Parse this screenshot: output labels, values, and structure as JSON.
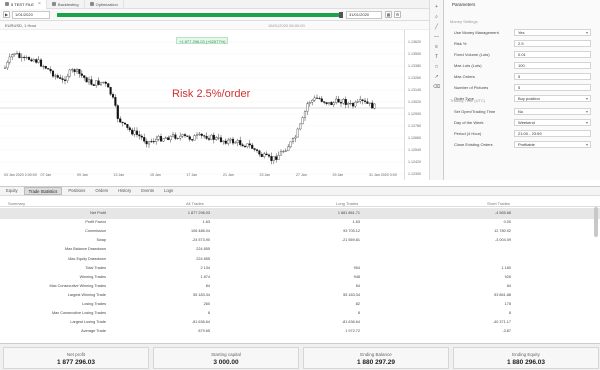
{
  "tabs": [
    {
      "label": "5 TEST FILE",
      "active": true
    },
    {
      "label": "Backtesting",
      "active": false
    },
    {
      "label": "Optimization",
      "active": false
    }
  ],
  "toolbar": {
    "start_date": "1/01/2020",
    "end_date": "31/01/2020",
    "progress_pct": 100
  },
  "chart": {
    "symbol": "EURUSD, 1 Hour",
    "cursor_time": "16/01/2020 06:00:00",
    "profit_label": "+1 877 296.03 (+62577%)",
    "annotation": "Risk 2.5%/order",
    "price_labels": [
      "1.13620",
      "1.13500",
      "1.13380",
      "1.13260",
      "1.13140",
      "1.13020",
      "1.12900",
      "1.12780",
      "1.12660",
      "1.12540",
      "1.12420",
      "1.12300"
    ],
    "current_price": "1.12700",
    "time_labels": [
      "03 Jan 2020 2:00:00",
      "07 Jan",
      "09 Jan",
      "13 Jan",
      "15 Jan",
      "17 Jan",
      "21 Jan",
      "23 Jan",
      "27 Jan",
      "29 Jan",
      "31 Jan 2020 0:00"
    ]
  },
  "params": {
    "title": "Parameters",
    "section1": "Money Settings",
    "rows1": [
      {
        "label": "Use Money Management",
        "value": "Yes",
        "select": true
      },
      {
        "label": "Risk %",
        "value": "2.5",
        "select": false
      },
      {
        "label": "Fixed Volume (Lots)",
        "value": "0.01",
        "select": false
      },
      {
        "label": "Max Lots (Lots)",
        "value": "100",
        "select": false
      },
      {
        "label": "Max Orders",
        "value": "5",
        "select": false
      },
      {
        "label": "Number of Pictures",
        "value": "5",
        "select": false
      },
      {
        "label": "Order Type",
        "value": "Buy position",
        "select": true
      }
    ],
    "section2": "Trading Time (UTC)",
    "rows2": [
      {
        "label": "Set Open/Trading Time",
        "value": "No",
        "select": true
      },
      {
        "label": "Day of the Week",
        "value": "Weekend",
        "select": true
      },
      {
        "label": "Period (4 Hour)",
        "value": "21:00 - 23:59",
        "select": false
      },
      {
        "label": "Close Existing Orders",
        "value": "Profitable",
        "select": true
      }
    ]
  },
  "bottom_tabs": [
    {
      "label": "Equity",
      "active": false
    },
    {
      "label": "Trade Statistics",
      "active": true
    },
    {
      "label": "Positions",
      "active": false
    },
    {
      "label": "Orders",
      "active": false
    },
    {
      "label": "History",
      "active": false
    },
    {
      "label": "Events",
      "active": false
    },
    {
      "label": "Logs",
      "active": false
    }
  ],
  "table": {
    "headers": [
      "Summary",
      "All Trades",
      "Long Trades",
      "Short Trades"
    ],
    "rows": [
      {
        "name": "Net Profit",
        "all": "1 877 296.03",
        "long": "1 881 861.71",
        "short": "-4 565.68",
        "hl": true
      },
      {
        "name": "Profit Factor",
        "all": "1.63",
        "long": "1.63",
        "short": "0.00",
        "hl": false
      },
      {
        "name": "Commission",
        "all": "106 486.04",
        "long": "93 705.12",
        "short": "12 780.92",
        "hl": false
      },
      {
        "name": "Swap",
        "all": "-24 573.90",
        "long": "-21 569.81",
        "short": "-3 004.09",
        "hl": false
      },
      {
        "name": "Max Balance Drawdown",
        "all": "224 855",
        "long": "",
        "short": "",
        "hl": false
      },
      {
        "name": "Max Equity Drawdown",
        "all": "224 855",
        "long": "",
        "short": "",
        "hl": false
      },
      {
        "name": "Total Trades",
        "all": "2 134",
        "long": "954",
        "short": "1 180",
        "hl": false
      },
      {
        "name": "Winning Trades",
        "all": "1 874",
        "long": "948",
        "short": "926",
        "hl": false
      },
      {
        "name": "Max Consecutive Winning Trades",
        "all": "84",
        "long": "84",
        "short": "84",
        "hl": false
      },
      {
        "name": "Largest Winning Trade",
        "all": "55 183.34",
        "long": "55 183.34",
        "short": "53 861.88",
        "hl": false
      },
      {
        "name": "Losing Trades",
        "all": "260",
        "long": "82",
        "short": "178",
        "hl": false
      },
      {
        "name": "Max Consecutive Losing Trades",
        "all": "8",
        "long": "8",
        "short": "8",
        "hl": false
      },
      {
        "name": "Largest Losing Trade",
        "all": "-81 636.64",
        "long": "-81 636.64",
        "short": "-40 371.17",
        "hl": false
      },
      {
        "name": "Average Trade",
        "all": "879.65",
        "long": "1 972.72",
        "short": "-3.87",
        "hl": false
      }
    ]
  },
  "totals": [
    {
      "label": "Net profit",
      "value": "1 877 296.03"
    },
    {
      "label": "Starting capital",
      "value": "3 000.00"
    },
    {
      "label": "Ending Balance",
      "value": "1 880 297.29"
    },
    {
      "label": "Ending Equity",
      "value": "1 880 296.03"
    }
  ],
  "colors": {
    "accent": "#1aa34a",
    "annotation": "#d13030",
    "selection": "#e6e6e6"
  },
  "icons": [
    "chart-icon",
    "close-icon",
    "play-icon",
    "calendar-icon",
    "crosshair-icon",
    "zoom-icon",
    "line-icon"
  ]
}
